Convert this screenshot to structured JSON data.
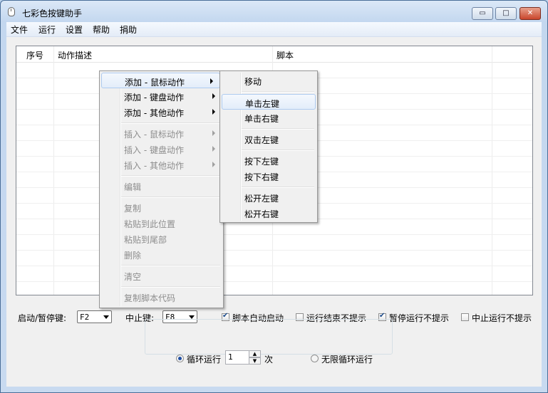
{
  "window": {
    "title": "七彩色按键助手"
  },
  "window_buttons": {
    "minimize": "▭",
    "maximize": "□",
    "close": "✕"
  },
  "menubar": {
    "items": [
      "文件",
      "运行",
      "设置",
      "帮助",
      "捐助"
    ]
  },
  "table": {
    "columns": [
      "序号",
      "动作描述",
      "脚本"
    ]
  },
  "controls": {
    "start_pause_label": "启动/暂停键:",
    "start_pause_value": "F2",
    "stop_label": "中止键:",
    "stop_value": "F8",
    "checkboxes": [
      {
        "label": "脚本自动启动",
        "checked": true
      },
      {
        "label": "运行结束不提示",
        "checked": false
      },
      {
        "label": "暂停运行不提示",
        "checked": true
      },
      {
        "label": "中止运行不提示",
        "checked": false
      }
    ],
    "loop_label": "循环运行",
    "loop_count": "1",
    "times_label": "次",
    "infinite_label": "无限循环运行",
    "loop_selected": "循环运行"
  },
  "context_menu": {
    "add_mouse": "添加 - 鼠标动作",
    "add_keyboard": "添加 - 键盘动作",
    "add_other": "添加 - 其他动作",
    "insert_mouse": "插入 - 鼠标动作",
    "insert_keyboard": "插入 - 键盘动作",
    "insert_other": "插入 - 其他动作",
    "edit": "编辑",
    "copy": "复制",
    "paste_here": "粘贴到此位置",
    "paste_end": "粘贴到尾部",
    "delete": "删除",
    "clear": "清空",
    "copy_code": "复制脚本代码"
  },
  "submenu": {
    "move": "移动",
    "left_click": "单击左键",
    "right_click": "单击右键",
    "double_left": "双击左键",
    "press_left": "按下左键",
    "press_right": "按下右键",
    "release_left": "松开左键",
    "release_right": "松开右键"
  }
}
